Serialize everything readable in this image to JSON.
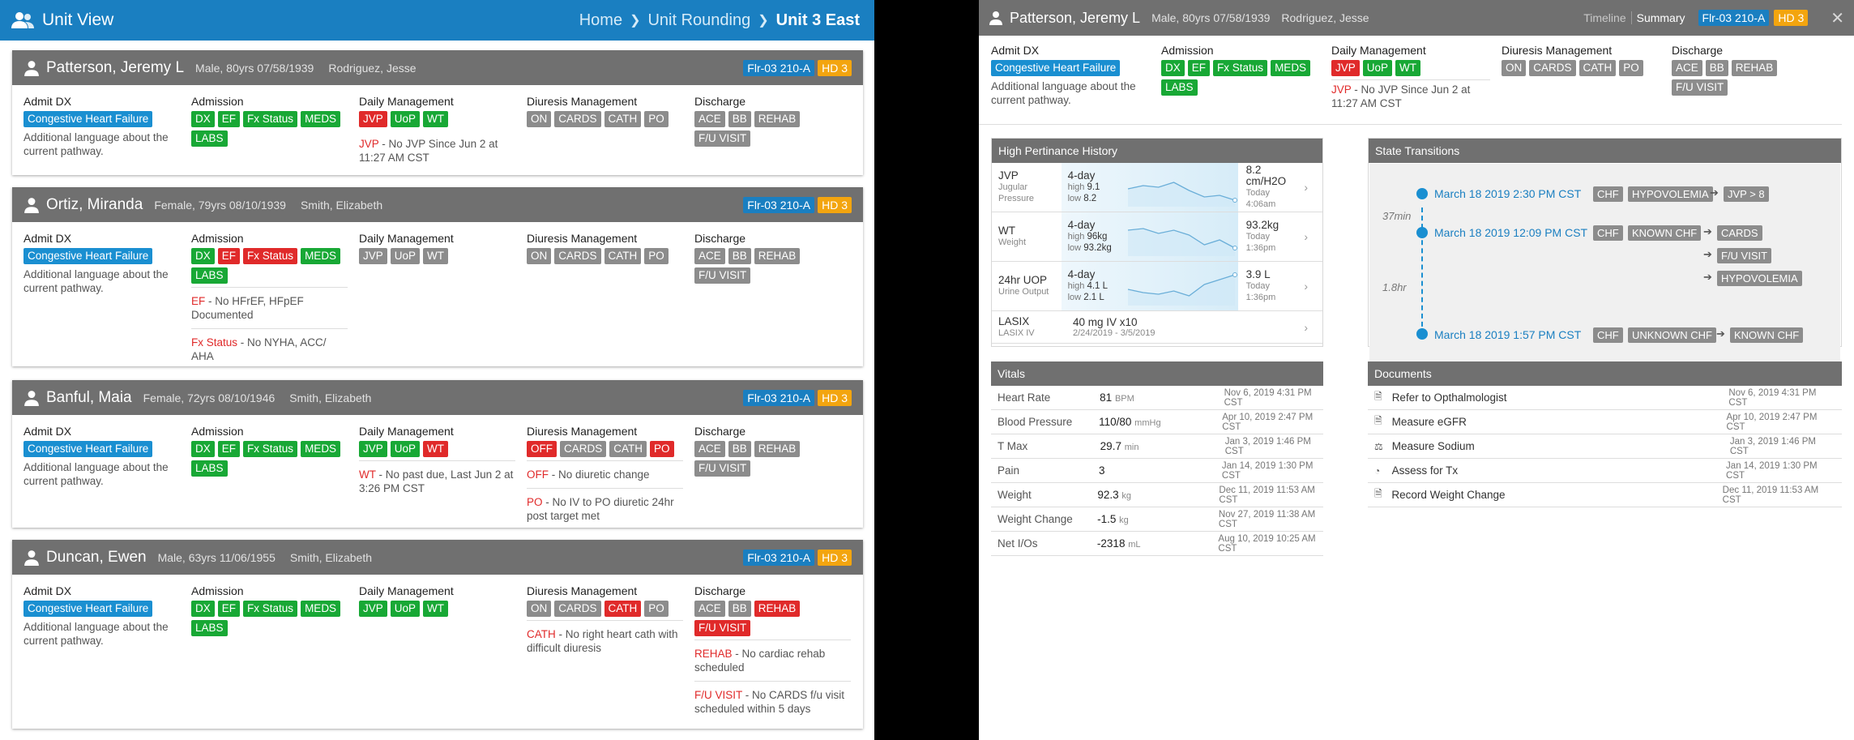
{
  "left": {
    "title": "Unit View",
    "breadcrumbs": [
      "Home",
      "Unit Rounding",
      "Unit 3 East"
    ]
  },
  "col_headers": [
    "Admit DX",
    "Admission",
    "Daily Management",
    "Diuresis Management",
    "Discharge"
  ],
  "patients": [
    {
      "name": "Patterson, Jeremy L",
      "info": "Male, 80yrs 07/58/1939",
      "doctor": "Rodriguez, Jesse",
      "location": "Flr-03 210-A",
      "hd": "HD 3",
      "dx": "Congestive Heart Failure",
      "dx_desc": "Additional language about the current pathway.",
      "admission": [
        "DX",
        "EF",
        "Fx Status",
        "MEDS",
        "LABS"
      ],
      "daily": [
        "JVP",
        "UoP",
        "WT"
      ],
      "diuresis": [
        "ON",
        "CARDS",
        "CATH",
        "PO"
      ],
      "discharge": [
        "ACE",
        "BB",
        "REHAB",
        "F/U VISIT"
      ],
      "daily_notes": [
        {
          "key": "JVP",
          "text": " - No JVP Since Jun 2 at 11:27 AM CST"
        }
      ]
    },
    {
      "name": "Ortiz, Miranda",
      "info": "Female, 79yrs 08/10/1939",
      "doctor": "Smith, Elizabeth",
      "location": "Flr-03 210-A",
      "hd": "HD 3",
      "dx": "Congestive Heart Failure",
      "dx_desc": "Additional language about the current pathway.",
      "admission": [
        "DX",
        "EF",
        "Fx Status",
        "MEDS",
        "LABS"
      ],
      "daily": [
        "JVP",
        "UoP",
        "WT"
      ],
      "diuresis": [
        "ON",
        "CARDS",
        "CATH",
        "PO"
      ],
      "discharge": [
        "ACE",
        "BB",
        "REHAB",
        "F/U VISIT"
      ],
      "admission_notes": [
        {
          "key": "EF",
          "text": " - No HFrEF, HFpEF Documented"
        },
        {
          "key": "Fx Status",
          "text": " - No NYHA, ACC/ AHA"
        }
      ]
    },
    {
      "name": "Banful, Maia",
      "info": "Female, 72yrs 08/10/1946",
      "doctor": "Smith, Elizabeth",
      "location": "Flr-03 210-A",
      "hd": "HD 3",
      "dx": "Congestive Heart Failure",
      "dx_desc": "Additional language about the current pathway.",
      "admission": [
        "DX",
        "EF",
        "Fx Status",
        "MEDS",
        "LABS"
      ],
      "daily": [
        "JVP",
        "UoP",
        "WT"
      ],
      "diuresis": [
        "OFF",
        "CARDS",
        "CATH",
        "PO"
      ],
      "discharge": [
        "ACE",
        "BB",
        "REHAB",
        "F/U VISIT"
      ],
      "daily_notes": [
        {
          "key": "WT",
          "text": " - No past due, Last Jun 2 at 3:26 PM CST"
        }
      ],
      "diuresis_notes": [
        {
          "key": "OFF",
          "text": " - No diuretic change"
        },
        {
          "key": "PO",
          "text": " - No IV to PO diuretic 24hr post target met"
        }
      ]
    },
    {
      "name": "Duncan, Ewen",
      "info": "Male, 63yrs 11/06/1955",
      "doctor": "Smith, Elizabeth",
      "location": "Flr-03 210-A",
      "hd": "HD 3",
      "dx": "Congestive Heart Failure",
      "dx_desc": "Additional language about the current pathway.",
      "admission": [
        "DX",
        "EF",
        "Fx Status",
        "MEDS",
        "LABS"
      ],
      "daily": [
        "JVP",
        "UoP",
        "WT"
      ],
      "diuresis": [
        "ON",
        "CARDS",
        "CATH",
        "PO"
      ],
      "discharge": [
        "ACE",
        "BB",
        "REHAB",
        "F/U VISIT"
      ],
      "diuresis_notes": [
        {
          "key": "CATH",
          "text": " - No right heart cath with difficult diuresis"
        }
      ],
      "discharge_notes": [
        {
          "key": "REHAB",
          "text": " - No cardiac rehab scheduled"
        },
        {
          "key": "F/U VISIT",
          "text": " - No CARDS f/u visit scheduled within 5 days"
        }
      ]
    }
  ],
  "detail": {
    "name": "Patterson, Jeremy L",
    "info": "Male, 80yrs 07/58/1939",
    "doctor": "Rodriguez, Jesse",
    "tab_timeline": "Timeline",
    "tab_summary": "Summary",
    "location": "Flr-03 210-A",
    "hd": "HD 3",
    "close": "✕",
    "dx": "Congestive Heart Failure",
    "dx_desc": "Additional language about the current pathway.",
    "admission": [
      "DX",
      "EF",
      "Fx Status",
      "MEDS",
      "LABS"
    ],
    "daily": [
      "JVP",
      "UoP",
      "WT"
    ],
    "diuresis": [
      "ON",
      "CARDS",
      "CATH",
      "PO"
    ],
    "discharge": [
      "ACE",
      "BB",
      "REHAB",
      "F/U VISIT"
    ],
    "daily_note_key": "JVP",
    "daily_note_text": " - No JVP Since Jun 2 at 11:27 AM CST",
    "history_title": "High Pertinance History",
    "history": [
      {
        "name": "JVP",
        "sub": "Jugular Pressure",
        "span": "4-day",
        "high_l": "high",
        "high": "9.1",
        "low_l": "low",
        "low": "8.2",
        "value": "8.2 cm/H2O",
        "day": "Today",
        "time": "4:06am",
        "trend": [
          0.55,
          0.45,
          0.5,
          0.35,
          0.6,
          0.8,
          0.75,
          0.9
        ]
      },
      {
        "name": "WT",
        "sub": "Weight",
        "span": "4-day",
        "high_l": "high",
        "high": "96kg",
        "low_l": "low",
        "low": "93.2kg",
        "value": "93.2kg",
        "day": "Today",
        "time": "1:36pm",
        "trend": [
          0.3,
          0.25,
          0.4,
          0.3,
          0.45,
          0.75,
          0.6,
          0.85
        ]
      },
      {
        "name": "24hr UOP",
        "sub": "Urine Output",
        "span": "4-day",
        "high_l": "high",
        "high": "4.1 L",
        "low_l": "low",
        "low": "2.1 L",
        "value": "3.9 L",
        "day": "Today",
        "time": "1:36pm",
        "trend": [
          0.6,
          0.7,
          0.75,
          0.65,
          0.8,
          0.45,
          0.3,
          0.15
        ]
      },
      {
        "name": "LASIX",
        "sub": "LASIX IV",
        "dose": "40 mg IV x10",
        "range": "2/24/2019 - 3/5/2019"
      }
    ],
    "vitals_title": "Vitals",
    "vitals": [
      {
        "name": "Heart Rate",
        "value": "81",
        "unit": "BPM",
        "date": "Nov 6, 2019 4:31 PM CST"
      },
      {
        "name": "Blood Pressure",
        "value": "110/80",
        "unit": "mmHg",
        "date": "Apr 10, 2019 2:47 PM CST"
      },
      {
        "name": "T Max",
        "value": "29.7",
        "unit": "min",
        "date": "Jan 3, 2019 1:46 PM CST"
      },
      {
        "name": "Pain",
        "value": "3",
        "unit": "",
        "date": "Jan 14, 2019 1:30 PM CST"
      },
      {
        "name": "Weight",
        "value": "92.3",
        "unit": "kg",
        "date": "Dec 11, 2019 11:53 AM CST"
      },
      {
        "name": "Weight Change",
        "value": "-1.5",
        "unit": "kg",
        "date": "Nov 27, 2019 11:38 AM CST"
      },
      {
        "name": "Net I/Os",
        "value": "-2318",
        "unit": "mL",
        "date": "Aug 10, 2019 10:25 AM CST"
      }
    ],
    "state_title": "State Transitions",
    "states": {
      "t1": "March 18 2019 2:30 PM CST",
      "t2": "March 18 2019 12:09 PM CST",
      "t3": "March 18 2019 1:57 PM CST",
      "gap1": "37min",
      "gap2": "1.8hr",
      "chf": "CHF",
      "hypo": "HYPOVOLEMIA",
      "jvp": "JVP > 8",
      "known": "KNOWN CHF",
      "cards": "CARDS",
      "fu": "F/U VISIT",
      "hypo2": "HYPOVOLEMIA",
      "unknown": "UNKNOWN CHF",
      "known2": "KNOWN CHF"
    },
    "documents_title": "Documents",
    "documents": [
      {
        "name": "Refer to Opthalmologist",
        "date": "Nov 6, 2019 4:31 PM CST",
        "icon": "document-icon"
      },
      {
        "name": "Measure eGFR",
        "date": "Apr 10, 2019 2:47 PM CST",
        "icon": "document-icon"
      },
      {
        "name": "Measure Sodium",
        "date": "Jan 3, 2019 1:46 PM CST",
        "icon": "scale-icon"
      },
      {
        "name": "Assess for Tx",
        "date": "Jan 14, 2019 1:30 PM CST",
        "icon": "gauge-icon"
      },
      {
        "name": "Record Weight Change",
        "date": "Dec 11, 2019 11:53 AM CST",
        "icon": "document-icon"
      }
    ]
  }
}
